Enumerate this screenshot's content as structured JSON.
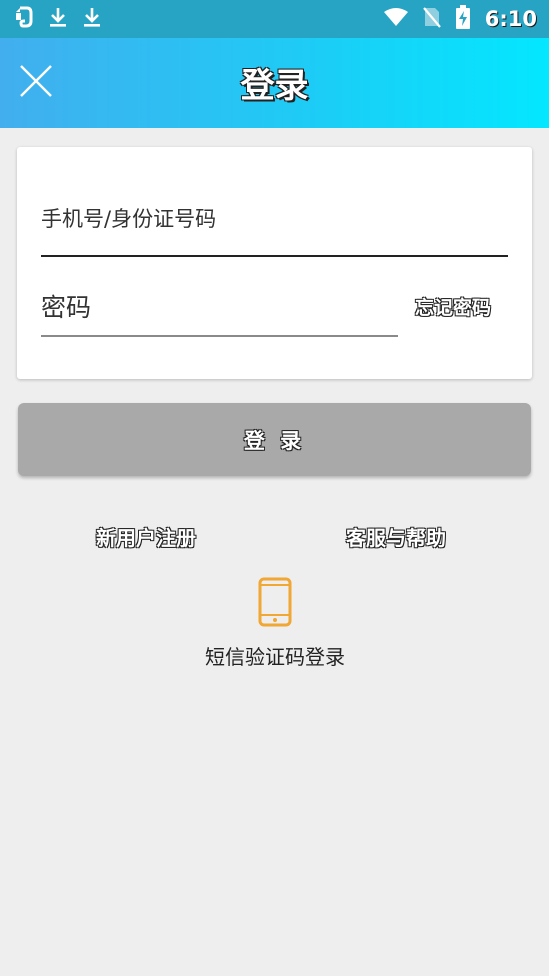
{
  "status_bar": {
    "time": "6:10",
    "background_color": "#27a3c4"
  },
  "header": {
    "title": "登录",
    "gradient_start": "#42aeee",
    "gradient_end": "#03e7ff"
  },
  "form": {
    "phone_placeholder": "手机号/身份证号码",
    "password_placeholder": "密码",
    "forgot_password_label": "忘记密码"
  },
  "login_button": {
    "label": "登 录",
    "color": "#a9a9a9"
  },
  "links": {
    "register": "新用户注册",
    "help": "客服与帮助"
  },
  "sms_login": {
    "label": "短信验证码登录",
    "icon": "mobile-phone-icon",
    "icon_color": "#f0a733"
  }
}
